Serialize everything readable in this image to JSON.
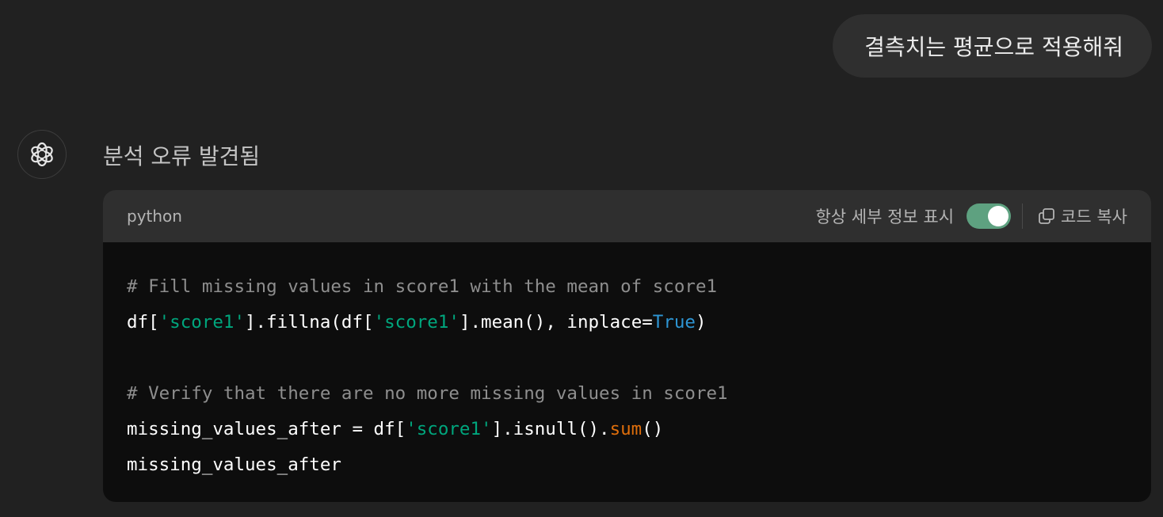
{
  "user_message": "결측치는 평균으로 적용해줘",
  "assistant": {
    "avatar_icon": "openai-logo-icon",
    "status": "분석 오류 발견됨"
  },
  "code_block": {
    "language": "python",
    "toggle_label": "항상 세부 정보 표시",
    "toggle_on": true,
    "copy_label": "코드 복사",
    "copy_icon": "copy-icon",
    "lines": [
      {
        "kind": "comment",
        "text": "# Fill missing values in score1 with the mean of score1"
      },
      {
        "kind": "code",
        "p1": "df[",
        "s1": "'score1'",
        "p2": "].fillna(df[",
        "s2": "'score1'",
        "p3": "].mean(), inplace=",
        "k1": "True",
        "p4": ")"
      },
      {
        "kind": "blank",
        "text": ""
      },
      {
        "kind": "comment",
        "text": "# Verify that there are no more missing values in score1"
      },
      {
        "kind": "code",
        "p1": "missing_values_after = df[",
        "s1": "'score1'",
        "p2": "].isnull().",
        "f1": "sum",
        "p3": "()"
      },
      {
        "kind": "code",
        "p1": "missing_values_after"
      }
    ]
  },
  "colors": {
    "background": "#212121",
    "bubble": "#2f2f2f",
    "code_bg": "#0d0d0d",
    "toggle_on": "#5ea180",
    "string": "#00a67d",
    "keyword_const": "#2e95d3",
    "builtin_func": "#df6e0b",
    "comment": "#8e8e8e"
  }
}
